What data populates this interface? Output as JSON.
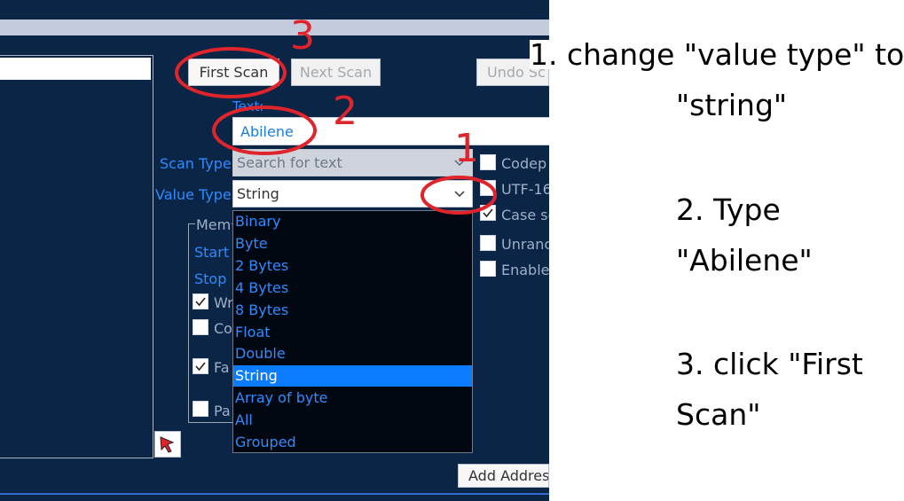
{
  "buttons": {
    "first_scan": "First Scan",
    "next_scan": "Next Scan",
    "undo_scan": "Undo Sc",
    "add_address": "Add Addres"
  },
  "scan_panel": {
    "text_label": "Text:",
    "text_value": "Abilene",
    "scan_type_label": "Scan Type",
    "scan_type_value": "Search for text",
    "value_type_label": "Value Type",
    "value_type_value": "String"
  },
  "options": {
    "codepage": "Codep",
    "utf16": "UTF-16",
    "case_sensitive": "Case se",
    "unrandomizer": "Unranc",
    "enable_speedhack": "Enable"
  },
  "memory": {
    "group_label": "Mem",
    "start": "Start",
    "stop": "Stop",
    "writable": "Wr",
    "copy_on_write": "Co",
    "fast_scan": "Fa",
    "pause": "Pa"
  },
  "dropdown": {
    "items": [
      "Binary",
      "Byte",
      "2 Bytes",
      "4 Bytes",
      "8 Bytes",
      "Float",
      "Double",
      "String",
      "Array of byte",
      "All",
      "Grouped"
    ],
    "selected_index": 7
  },
  "annotations": {
    "step1": "1",
    "step2": "2",
    "step3": "3",
    "color": "#e0242b"
  },
  "instructions": {
    "l1": "1. change \"value type\" to",
    "l2": "\"string\"",
    "l3": "2. Type",
    "l4": "\"Abilene\"",
    "l5": "3. click \"First",
    "l6": "Scan\""
  },
  "colors": {
    "background": "#0b2546",
    "label": "#2f8bff",
    "selection": "#0a7cff"
  },
  "icons": {
    "dropdown_arrow": "chevron-down-icon",
    "cursor_tool": "pointer-arrow-icon",
    "check": "checkmark-icon"
  }
}
